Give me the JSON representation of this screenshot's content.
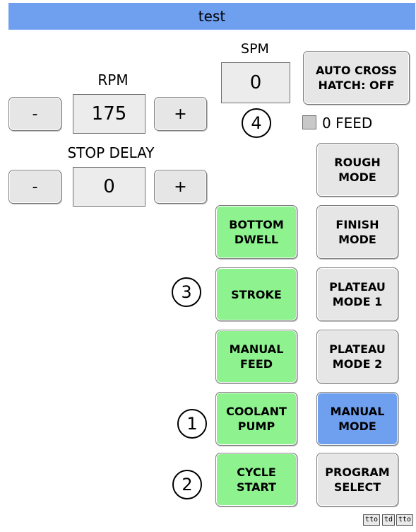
{
  "title": "test",
  "rpm": {
    "label": "RPM",
    "value": "175",
    "minus_label": "-",
    "plus_label": "+"
  },
  "stop_delay": {
    "label": "STOP DELAY",
    "value": "0",
    "minus_label": "-",
    "plus_label": "+"
  },
  "spm": {
    "label": "SPM",
    "value": "0"
  },
  "auto_cross_hatch_label": "AUTO CROSS\nHATCH: OFF",
  "zero_feed_label": "0 FEED",
  "markers": [
    "1",
    "2",
    "3",
    "4"
  ],
  "left_buttons": {
    "bottom_dwell": "BOTTOM\nDWELL",
    "stroke": "STROKE",
    "manual_feed": "MANUAL\nFEED",
    "coolant_pump": "COOLANT\nPUMP",
    "cycle_start": "CYCLE\nSTART"
  },
  "right_buttons": {
    "rough_mode": "ROUGH\nMODE",
    "finish_mode": "FINISH\nMODE",
    "plateau_mode_1": "PLATEAU\nMODE 1",
    "plateau_mode_2": "PLATEAU\nMODE 2",
    "manual_mode": "MANUAL\nMODE",
    "program_select": "PROGRAM\nSELECT"
  },
  "footer_links": [
    "tto",
    "td",
    "tto"
  ],
  "colors": {
    "active_green": "#8ef28f",
    "selected_blue": "#6fa0f0",
    "default_gray": "#e6e6e6"
  }
}
